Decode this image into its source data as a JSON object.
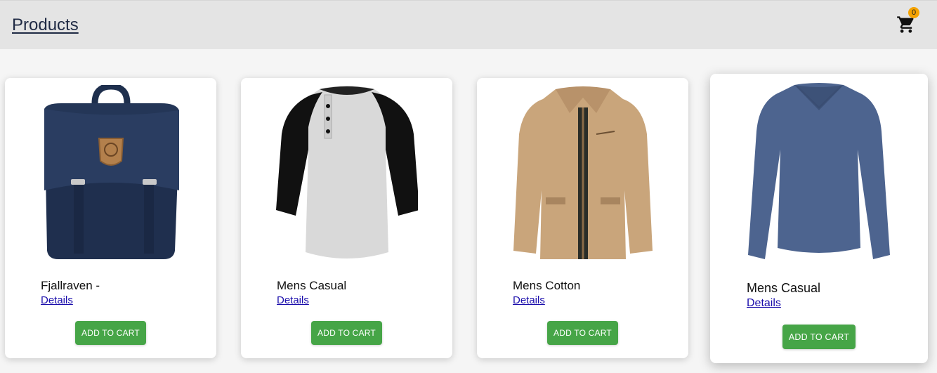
{
  "header": {
    "title": "Products",
    "cart_count": "0"
  },
  "products": [
    {
      "title": "Fjallraven -",
      "details_label": "Details",
      "button_label": "ADD TO CART",
      "image": "navy-backpack"
    },
    {
      "title": "Mens Casual",
      "details_label": "Details",
      "button_label": "ADD TO CART",
      "image": "raglan-henley-tshirt"
    },
    {
      "title": "Mens Cotton",
      "details_label": "Details",
      "button_label": "ADD TO CART",
      "image": "khaki-cotton-jacket"
    },
    {
      "title": "Mens Casual",
      "details_label": "Details",
      "button_label": "ADD TO CART",
      "image": "blue-long-sleeve-shirt"
    }
  ],
  "colors": {
    "header_bg": "#e4e4e4",
    "button_green": "#46a547",
    "badge_orange": "#f5a300",
    "link_blue": "#1a0dab"
  }
}
